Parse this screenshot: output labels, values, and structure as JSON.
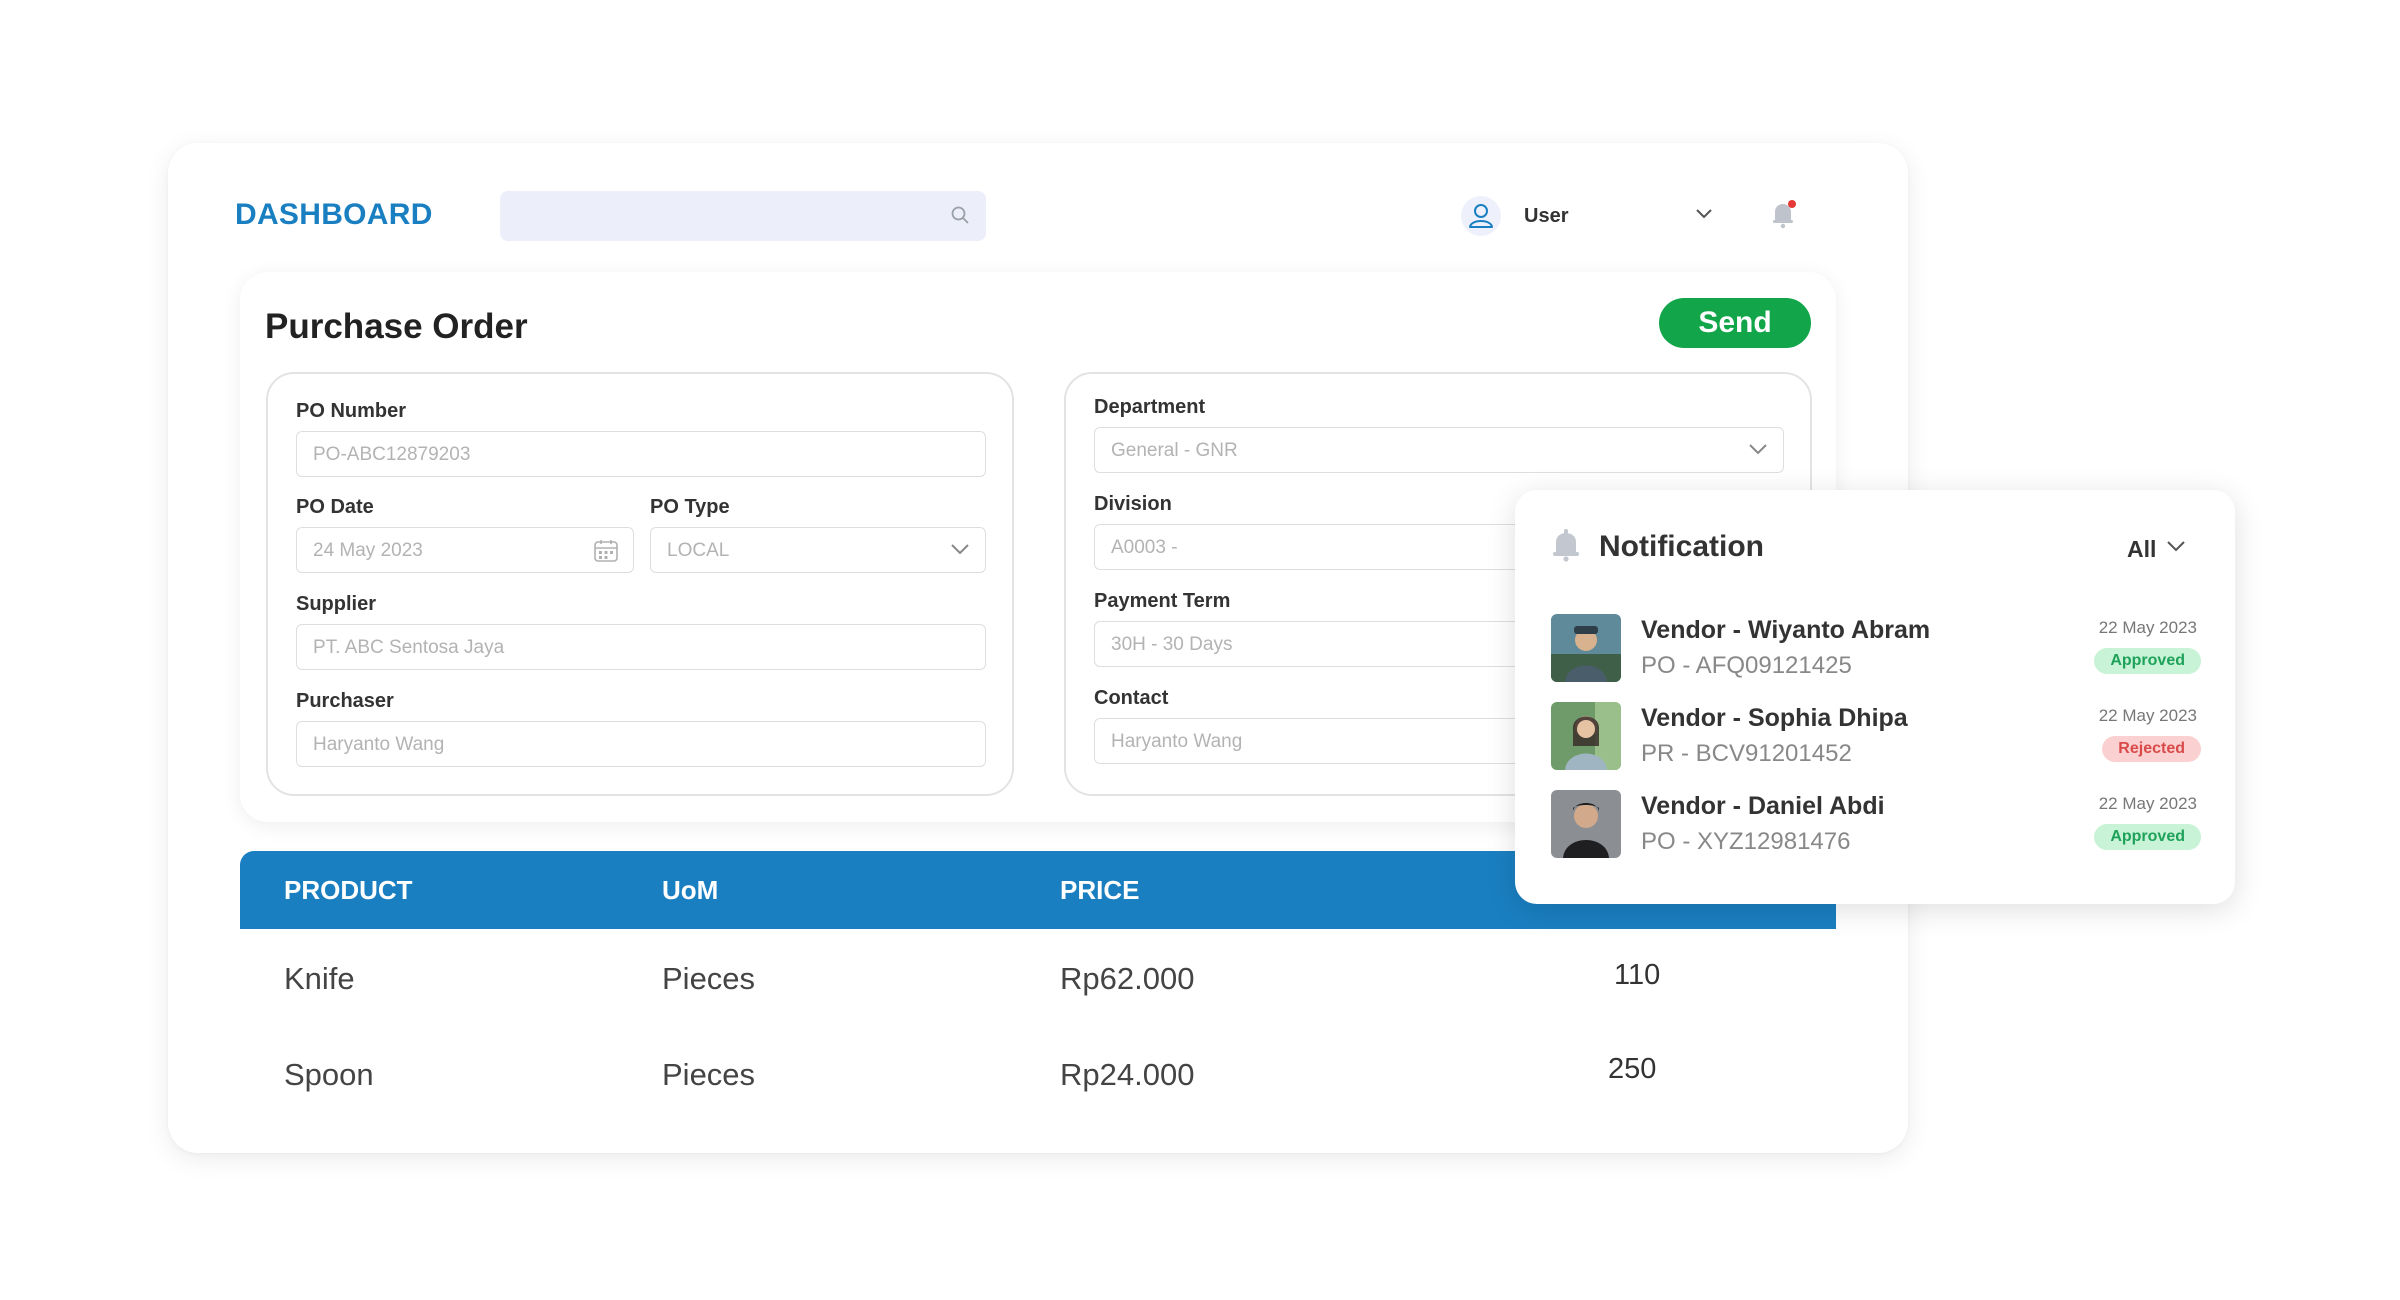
{
  "header": {
    "brand": "DASHBOARD",
    "search_placeholder": "",
    "user_label": "User"
  },
  "purchase_order": {
    "title": "Purchase Order",
    "send_label": "Send",
    "left_fields": {
      "po_number": {
        "label": "PO Number",
        "value": "PO-ABC12879203"
      },
      "po_date": {
        "label": "PO Date",
        "value": "24 May 2023"
      },
      "po_type": {
        "label": "PO Type",
        "value": "LOCAL"
      },
      "supplier": {
        "label": "Supplier",
        "value": "PT. ABC Sentosa Jaya"
      },
      "purchaser": {
        "label": "Purchaser",
        "value": "Haryanto Wang"
      }
    },
    "right_fields": {
      "department": {
        "label": "Department",
        "value": "General - GNR"
      },
      "division": {
        "label": "Division",
        "value": "A0003 -"
      },
      "payment_term": {
        "label": "Payment Term",
        "value": "30H - 30 Days"
      },
      "contact": {
        "label": "Contact",
        "value": "Haryanto Wang"
      }
    }
  },
  "table": {
    "columns": [
      "PRODUCT",
      "UoM",
      "PRICE"
    ],
    "rows": [
      {
        "product": "Knife",
        "uom": "Pieces",
        "price": "Rp62.000",
        "qty": "110"
      },
      {
        "product": "Spoon",
        "uom": "Pieces",
        "price": "Rp24.000",
        "qty": "250"
      }
    ]
  },
  "notification": {
    "title": "Notification",
    "filter": "All",
    "items": [
      {
        "name": "Vendor - Wiyanto Abram",
        "code": "PO -  AFQ09121425",
        "date": "22 May 2023",
        "status": "Approved"
      },
      {
        "name": "Vendor - Sophia Dhipa",
        "code": "PR -  BCV91201452",
        "date": "22 May 2023",
        "status": "Rejected"
      },
      {
        "name": "Vendor - Daniel Abdi",
        "code": "PO -  XYZ12981476",
        "date": "22 May 2023",
        "status": "Approved"
      }
    ]
  },
  "colors": {
    "accent": "#1a7fc1",
    "send_button": "#12a54a",
    "approved": "#1ea25a",
    "rejected": "#d94b4b"
  },
  "icons": [
    "search-icon",
    "user-icon",
    "chevron-down-icon",
    "bell-icon",
    "calendar-icon"
  ]
}
